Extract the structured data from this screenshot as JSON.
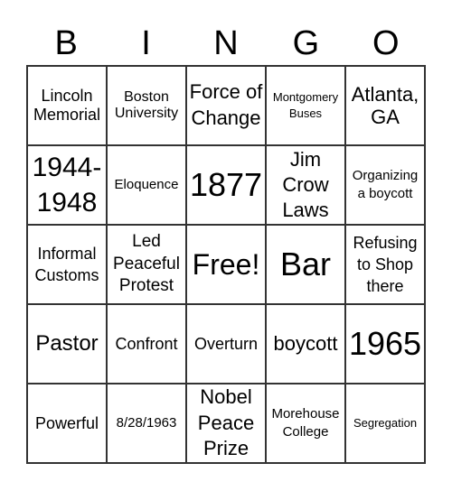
{
  "header": [
    "B",
    "I",
    "N",
    "G",
    "O"
  ],
  "cells": [
    "Lincoln Memorial",
    "Boston University",
    "Force of Change",
    "Montgomery Buses",
    "Atlanta, GA",
    "1944-1948",
    "Eloquence",
    "1877",
    "Jim Crow Laws",
    "Organizing a boycott",
    "Informal Customs",
    "Led Peaceful Protest",
    "Free!",
    "Bar",
    "Refusing to Shop there",
    "Pastor",
    "Confront",
    "Overturn",
    "boycott",
    "1965",
    "Powerful",
    "8/28/1963",
    "Nobel Peace Prize",
    "Morehouse College",
    "Segregation"
  ]
}
